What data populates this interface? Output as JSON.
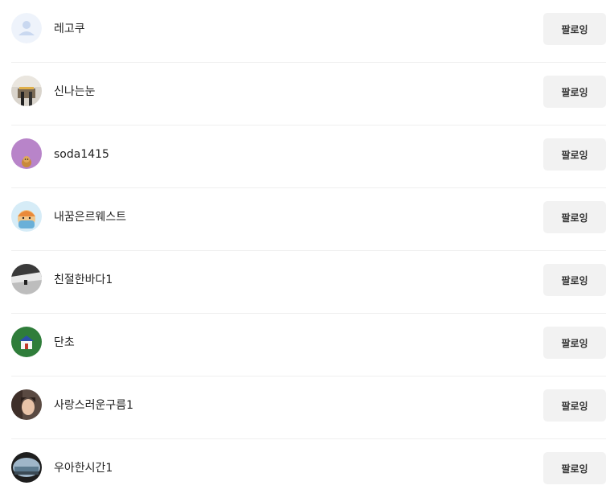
{
  "followers": [
    {
      "name": "레고쿠",
      "button": "팔로잉",
      "avatar": "default-user-avatar"
    },
    {
      "name": "신나는눈",
      "button": "팔로잉",
      "avatar": "photo-avatar-room"
    },
    {
      "name": "soda1415",
      "button": "팔로잉",
      "avatar": "purple-character-avatar"
    },
    {
      "name": "내꿈은르웨스트",
      "button": "팔로잉",
      "avatar": "cartoon-character-avatar"
    },
    {
      "name": "친절한바다1",
      "button": "팔로잉",
      "avatar": "grey-photo-avatar"
    },
    {
      "name": "단초",
      "button": "팔로잉",
      "avatar": "green-house-avatar"
    },
    {
      "name": "사랑스러운구름1",
      "button": "팔로잉",
      "avatar": "person-photo-avatar"
    },
    {
      "name": "우아한시간1",
      "button": "팔로잉",
      "avatar": "landscape-photo-avatar"
    }
  ]
}
